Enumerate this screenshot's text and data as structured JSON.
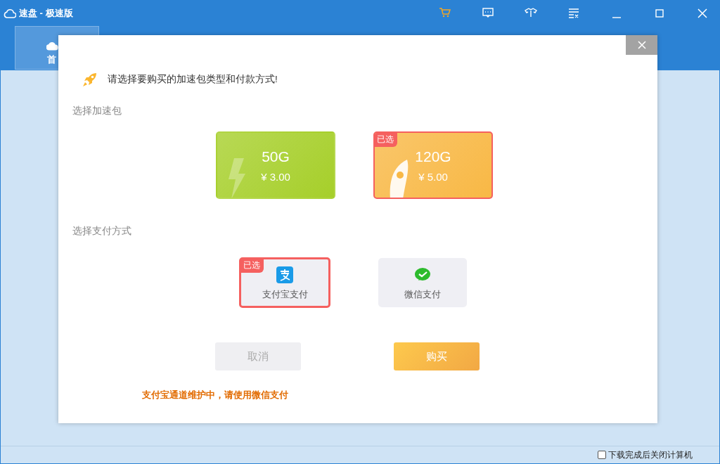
{
  "window": {
    "title": "速盘 - 极速版"
  },
  "nav_tabs": [
    {
      "label": "首",
      "selected": true
    }
  ],
  "dialog": {
    "prompt": "请选择要购买的加速包类型和付款方式!",
    "package_heading": "选择加速包",
    "packages": [
      {
        "size": "50G",
        "price": "¥ 3.00",
        "selected": false,
        "kind": "lightning",
        "color": "#a6cf2a"
      },
      {
        "size": "120G",
        "price": "¥ 5.00",
        "selected": true,
        "badge": "已选",
        "kind": "rocket",
        "color": "#f8b845"
      }
    ],
    "payment_heading": "选择支付方式",
    "payments": [
      {
        "label": "支付宝支付",
        "selected": true,
        "badge": "已选",
        "kind": "alipay"
      },
      {
        "label": "微信支付",
        "selected": false,
        "kind": "wechat"
      }
    ],
    "buttons": [
      {
        "label": "取消",
        "kind": "secondary"
      },
      {
        "label": "购买",
        "kind": "primary"
      }
    ],
    "notice": "支付宝通道维护中，请使用微信支付"
  },
  "status_bar": {
    "checkbox": {
      "label": "下载完成后关闭计算机",
      "checked": false
    }
  }
}
